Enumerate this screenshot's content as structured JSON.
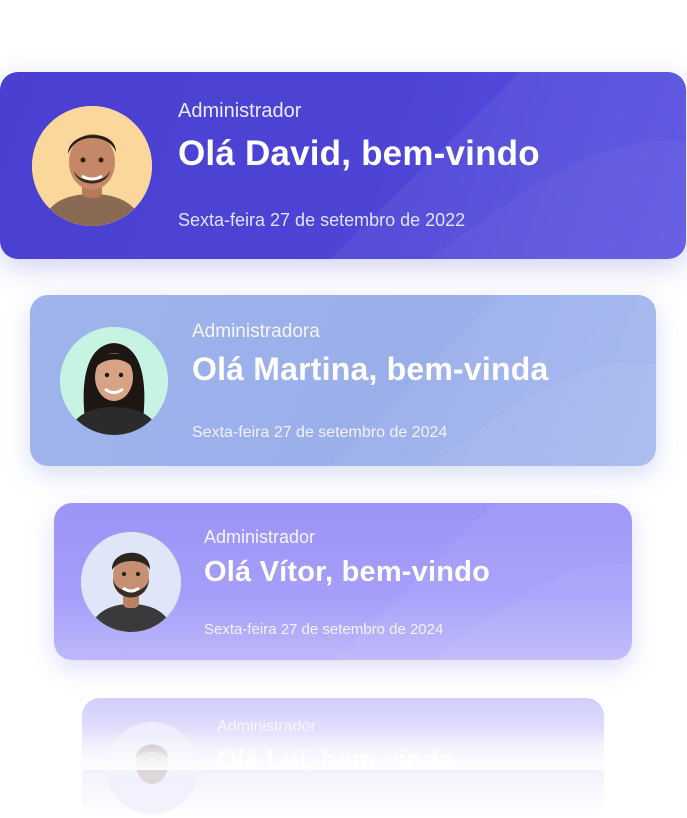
{
  "colors": {
    "card1": "#4d44d6",
    "card2": "#9aaeea",
    "card3": "#a59ffa",
    "card4": "#d6d3fb",
    "text": "#ffffff"
  },
  "cards": [
    {
      "avatar": "avatar-man-short-hair",
      "role": "Administrador",
      "greeting": "Olá David, bem-vindo",
      "date": "Sexta-feira 27 de setembro de 2022"
    },
    {
      "avatar": "avatar-woman-long-hair",
      "role": "Administradora",
      "greeting": "Olá Martina, bem-vinda",
      "date": "Sexta-feira 27 de setembro de 2024"
    },
    {
      "avatar": "avatar-man-beard",
      "role": "Administrador",
      "greeting": "Olá Vítor, bem-vindo",
      "date": "Sexta-feira 27 de setembro de 2024"
    },
    {
      "avatar": "avatar-faded",
      "role": "Administrador",
      "greeting": "Olá Luí, bem-vindo"
    }
  ]
}
